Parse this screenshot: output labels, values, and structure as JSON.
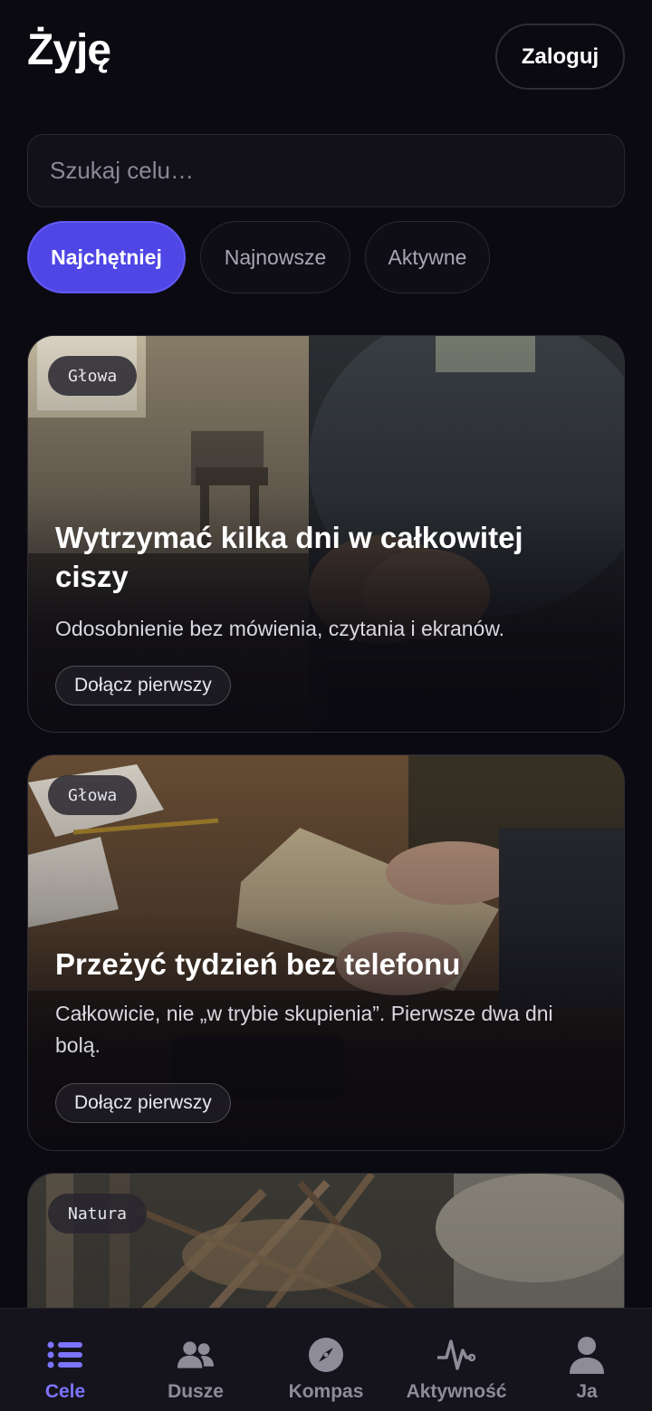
{
  "header": {
    "title": "Żyję",
    "login_label": "Zaloguj"
  },
  "search": {
    "placeholder": "Szukaj celu…",
    "value": ""
  },
  "filters": [
    {
      "label": "Najchętniej",
      "active": true
    },
    {
      "label": "Najnowsze",
      "active": false
    },
    {
      "label": "Aktywne",
      "active": false
    }
  ],
  "goals": [
    {
      "tag": "Głowa",
      "title": "Wytrzymać kilka dni w całkowitej ciszy",
      "description": "Odosobnienie bez mówienia, czytania i ekranów.",
      "join_label": "Dołącz pierwszy"
    },
    {
      "tag": "Głowa",
      "title": "Przeżyć tydzień bez telefonu",
      "description": "Całkowicie, nie „w trybie skupienia”. Pierwsze dwa dni bolą.",
      "join_label": "Dołącz pierwszy"
    },
    {
      "tag": "Natura",
      "title": "",
      "description": "",
      "join_label": ""
    }
  ],
  "nav": [
    {
      "label": "Cele",
      "icon": "list-icon",
      "active": true
    },
    {
      "label": "Dusze",
      "icon": "people-icon",
      "active": false
    },
    {
      "label": "Kompas",
      "icon": "compass-icon",
      "active": false
    },
    {
      "label": "Aktywność",
      "icon": "activity-icon",
      "active": false
    },
    {
      "label": "Ja",
      "icon": "user-icon",
      "active": false
    }
  ],
  "colors": {
    "background": "#0b0a11",
    "accent": "#4f46e5",
    "nav_active": "#7c73ff",
    "nav_inactive": "#8e8c99"
  }
}
